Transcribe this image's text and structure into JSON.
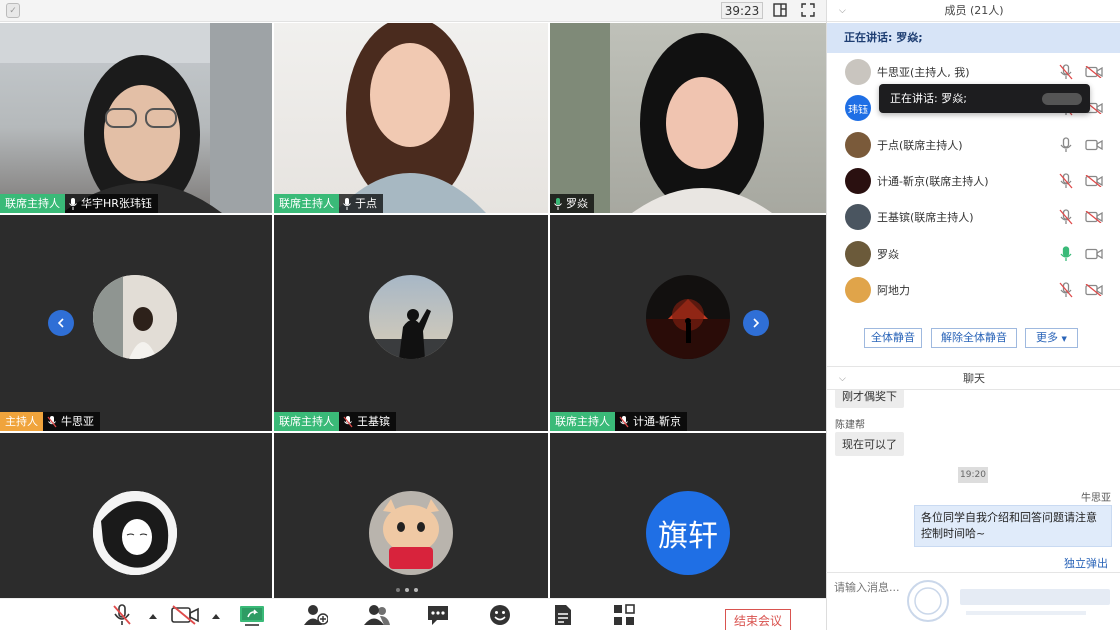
{
  "topbar": {
    "timer": "39:23"
  },
  "grid": {
    "tiles": [
      {
        "role": "联席主持人",
        "name": "华宇HR张玮钰"
      },
      {
        "role": "联席主持人",
        "name": "于点"
      },
      {
        "role": "",
        "name": "罗焱"
      },
      {
        "role": "主持人",
        "name": "牛思亚"
      },
      {
        "role": "联席主持人",
        "name": "王基镔"
      },
      {
        "role": "联席主持人",
        "name": "计通-靳京"
      },
      {
        "name": ""
      },
      {
        "name": ""
      },
      {
        "avatar_text": "旗轩",
        "avatar_color": "#1f6fe5"
      }
    ]
  },
  "toolbar": {
    "end_meeting": "结束会议"
  },
  "members": {
    "header": "成员 (21人)",
    "speaking_banner": "正在讲话: 罗焱;",
    "tooltip": "正在讲话: 罗焱;",
    "list": [
      {
        "name": "牛思亚(主持人, 我)",
        "avatar_text": "",
        "mic": "muted",
        "cam": "off"
      },
      {
        "name": "",
        "avatar_text": "玮钰",
        "mic": "muted",
        "cam": "off"
      },
      {
        "name": "于点(联席主持人)",
        "avatar_text": "",
        "mic": "on",
        "cam": "on"
      },
      {
        "name": "计通-靳京(联席主持人)",
        "avatar_text": "",
        "mic": "muted",
        "cam": "off"
      },
      {
        "name": "王基镔(联席主持人)",
        "avatar_text": "",
        "mic": "muted",
        "cam": "off"
      },
      {
        "name": "罗焱",
        "avatar_text": "",
        "mic": "speaking",
        "cam": "on"
      },
      {
        "name": "阿地力",
        "avatar_text": "",
        "mic": "muted",
        "cam": "off"
      }
    ],
    "buttons": {
      "mute_all": "全体静音",
      "unmute_all": "解除全体静音",
      "more": "更多"
    }
  },
  "chat": {
    "header": "聊天",
    "partial_message": "刚才偶奖下",
    "messages": [
      {
        "sender": "陈建帮",
        "text": "现在可以了"
      },
      {
        "time": "19:20"
      },
      {
        "sender": "牛思亚",
        "text": "各位同学自我介绍和回答问题请注意控制时间哈~"
      }
    ],
    "popout": "独立弹出",
    "input_placeholder": "请输入消息..."
  },
  "colors": {
    "accent_blue": "#2a64b8",
    "cohost_green": "#3aba78",
    "host_orange": "#f0a43c",
    "end_red": "#d9534f"
  }
}
